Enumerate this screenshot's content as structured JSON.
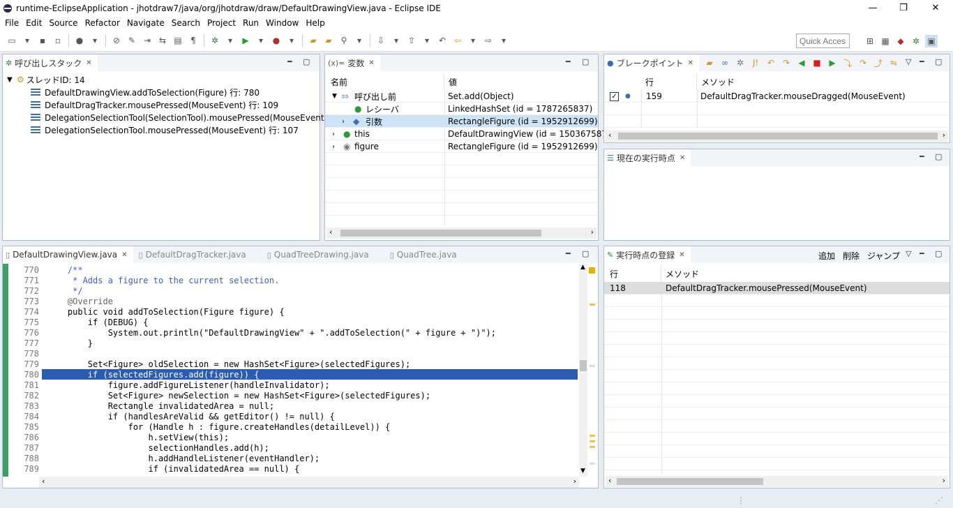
{
  "window": {
    "title": "runtime-EclipseApplication - jhotdraw7/java/org/jhotdraw/draw/DefaultDrawingView.java - Eclipse IDE",
    "minimize": "—",
    "restore": "❐",
    "close": "✕"
  },
  "menu": [
    "File",
    "Edit",
    "Source",
    "Refactor",
    "Navigate",
    "Search",
    "Project",
    "Run",
    "Window",
    "Help"
  ],
  "quick_access": {
    "placeholder": "Quick Access"
  },
  "callstack": {
    "tab": "呼び出しスタック",
    "thread": "スレッドID: 14",
    "frames": [
      "DefaultDrawingView.addToSelection(Figure) 行: 780",
      "DefaultDragTracker.mousePressed(MouseEvent) 行: 109",
      "DelegationSelectionTool(SelectionTool).mousePressed(MouseEvent) 行: 0",
      "DelegationSelectionTool.mousePressed(MouseEvent) 行: 107"
    ]
  },
  "variables": {
    "tab": "変数",
    "tab_prefix": "(x)=",
    "col_name": "名前",
    "col_value": "値",
    "rows": [
      {
        "name": "呼び出し前",
        "value": "Set.add(Object)"
      },
      {
        "name": "レシーバ",
        "value": "LinkedHashSet (id = 1787265837)"
      },
      {
        "name": "引数",
        "value": "RectangleFigure (id = 1952912699)"
      },
      {
        "name": "this",
        "value": "DefaultDrawingView (id = 150367587)"
      },
      {
        "name": "figure",
        "value": "RectangleFigure (id = 1952912699)"
      }
    ]
  },
  "breakpoints": {
    "tab": "ブレークポイント",
    "col_line": "行",
    "col_method": "メソッド",
    "rows": [
      {
        "line": "159",
        "method": "DefaultDragTracker.mouseDragged(MouseEvent)",
        "checked": true
      }
    ]
  },
  "current_point": {
    "tab": "現在の実行時点"
  },
  "editor": {
    "tabs": [
      "DefaultDrawingView.java",
      "DefaultDragTracker.java",
      "QuadTreeDrawing.java",
      "QuadTree.java"
    ],
    "line_numbers": [
      "770",
      "771",
      "772",
      "773",
      "774",
      "775",
      "776",
      "777",
      "778",
      "779",
      "780",
      "781",
      "782",
      "783",
      "784",
      "785",
      "786",
      "787",
      "788",
      "789"
    ],
    "lines": [
      "    /**",
      "     * Adds a figure to the current selection.",
      "     */",
      "    @Override",
      "    public void addToSelection(Figure figure) {",
      "        if (DEBUG) {",
      "            System.out.println(\"DefaultDrawingView\" + \".addToSelection(\" + figure + \")\");",
      "        }",
      "",
      "        Set<Figure> oldSelection = new HashSet<Figure>(selectedFigures);",
      "        if (selectedFigures.add(figure)) {",
      "            figure.addFigureListener(handleInvalidator);",
      "            Set<Figure> newSelection = new HashSet<Figure>(selectedFigures);",
      "            Rectangle invalidatedArea = null;",
      "            if (handlesAreValid && getEditor() != null) {",
      "                for (Handle h : figure.createHandles(detailLevel)) {",
      "                    h.setView(this);",
      "                    selectionHandles.add(h);",
      "                    h.addHandleListener(eventHandler);",
      "                    if (invalidatedArea == null) {"
    ]
  },
  "exec_points": {
    "tab": "実行時点の登録",
    "actions": [
      "追加",
      "削除",
      "ジャンプ"
    ],
    "col_line": "行",
    "col_method": "メソッド",
    "rows": [
      {
        "line": "118",
        "method": "DefaultDragTracker.mousePressed(MouseEvent)"
      }
    ]
  }
}
